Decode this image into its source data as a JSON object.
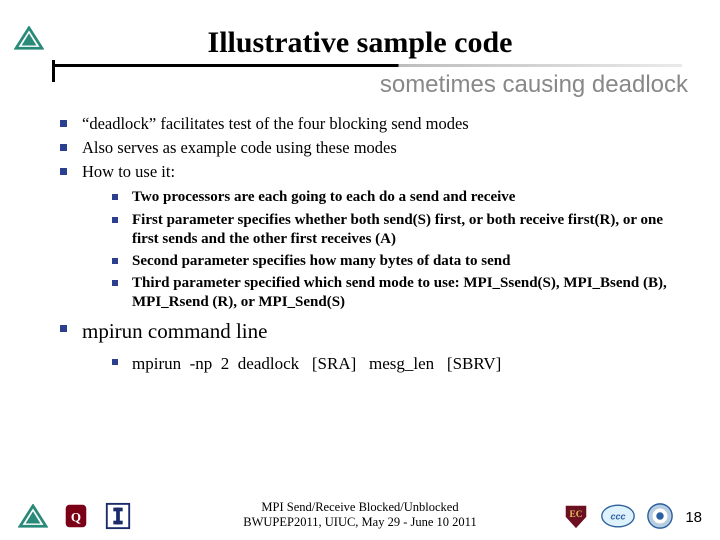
{
  "title": "Illustrative sample code",
  "subtitle": "sometimes causing deadlock",
  "bullets": {
    "b1": "“deadlock” facilitates test of the four blocking send modes",
    "b2": "Also serves as example code using these modes",
    "b3": "How to use it:",
    "sub": {
      "s1": "Two processors are each going to each do a send and receive",
      "s2": "First parameter specifies whether both send(S) first, or both receive first(R), or one first sends and the other first receives (A)",
      "s3": "Second parameter specifies how many bytes of data to send",
      "s4": "Third parameter specified which send mode to use: MPI_Ssend(S), MPI_Bsend (B), MPI_Rsend (R), or MPI_Send(S)"
    },
    "b4": "mpirun command line",
    "cmd": "mpirun  -np  2  deadlock   [SRA]   mesg_len   [SBRV]"
  },
  "footer": {
    "line1": "MPI Send/Receive Blocked/Unblocked",
    "line2": "BWUPEP2011, UIUC, May 29 - June 10 2011"
  },
  "page": "18",
  "icons": {
    "tri": "triangle-logo",
    "ou": "ou-logo",
    "illinois": "illinois-logo",
    "ec": "ec-logo",
    "ccc": "ccc-logo",
    "seal": "seal-logo"
  }
}
